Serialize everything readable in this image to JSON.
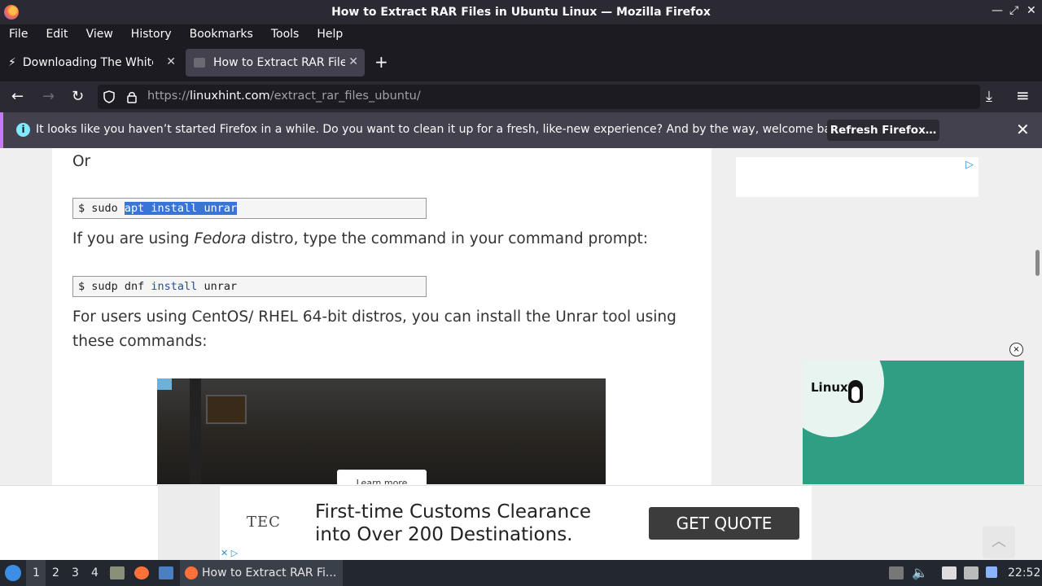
{
  "window": {
    "title": "How to Extract RAR Files in Ubuntu Linux — Mozilla Firefox",
    "minimize": "—",
    "maximize": "⤢",
    "close": "✕"
  },
  "menu": [
    "File",
    "Edit",
    "View",
    "History",
    "Bookmarks",
    "Tools",
    "Help"
  ],
  "tabs": [
    {
      "title": "Downloading The White House",
      "icon": "lightning-icon",
      "close": "✕"
    },
    {
      "title": "How to Extract RAR Files",
      "icon": "site-icon",
      "close": "✕"
    }
  ],
  "newtab": "+",
  "nav": {
    "back": "←",
    "forward": "→",
    "reload": "↻",
    "url_prefix": "https://",
    "url_domain": "linuxhint.com",
    "url_path": "/extract_rar_files_ubuntu/",
    "download": "⤓",
    "menu": "≡",
    "bookmark": "☆",
    "reader": "▤"
  },
  "notification": {
    "icon": "i",
    "text": "It looks like you haven’t started Firefox in a while. Do you want to clean it up for a fresh, like-new experience? And by the way, welcome back!",
    "button": "Refresh Firefox…",
    "close": "✕"
  },
  "article": {
    "or": "Or",
    "cmd1_prompt": "$ sudo ",
    "cmd1_selected": "apt install unrar",
    "fedora_pre": "If you are using ",
    "fedora_em": "Fedora",
    "fedora_post": " distro, type the command in your command prompt:",
    "cmd2_prompt": "$ sudp dnf ",
    "cmd2_kw": "install",
    "cmd2_rest": " unrar",
    "centos_line1": "For users using CentOS/ RHEL 64-bit distros, you can install the Unrar tool using",
    "centos_line2": "these commands:"
  },
  "image_ad": {
    "button": "Learn more"
  },
  "sidebar_ad": {
    "adchoices": "▷",
    "close": "×",
    "brand": "Linux"
  },
  "banner": {
    "brand": "TEC",
    "headline_line1": "First-time Customs Clearance",
    "headline_line2": "into Over 200 Destinations.",
    "cta": "GET QUOTE",
    "adx": "✕ ▷",
    "scroll_top": "︿"
  },
  "taskbar": {
    "workspaces": [
      "1",
      "2",
      "3",
      "4"
    ],
    "window_title": "How to Extract RAR Fi...",
    "clock": "22:52"
  }
}
